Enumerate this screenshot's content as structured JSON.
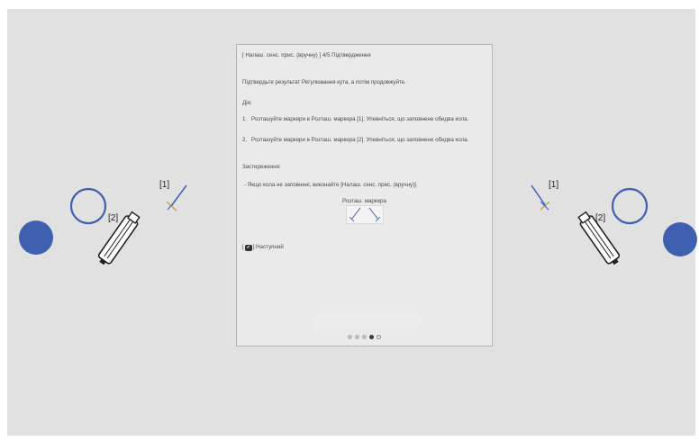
{
  "dialog": {
    "title": "[ Налаш. сенс. прис. (вручну) ]  4/5 Підтвердження",
    "intro": "Підтвердьте результат Регулювання кута, а потім продовжуйте.",
    "steps_heading": "Дія:",
    "steps": [
      {
        "num": "1.",
        "text": "Розташуйте маркери в Розташ. маркера [1]. Упевніться, що заповнене обидва кола."
      },
      {
        "num": "2.",
        "text": "Розташуйте маркери в Розташ. маркера [2]. Упевніться, що заповнене обидва кола."
      }
    ],
    "caution_heading": "Застереження:",
    "caution_note": "- Якщо кола не заповнені, виконайте [Налаш. сенс. прис. (вручну)].",
    "marker_caption": "Розташ. маркера",
    "next_prefix": "[",
    "next_icon": "✔",
    "next_label": "]:Наступний",
    "pages": 5,
    "current_page": 4
  },
  "illustration": {
    "marker1_label": "[1]",
    "marker2_label": "[2]"
  },
  "colors": {
    "accent_blue": "#3f5fb0",
    "screen_bg": "#e1e1e1"
  }
}
